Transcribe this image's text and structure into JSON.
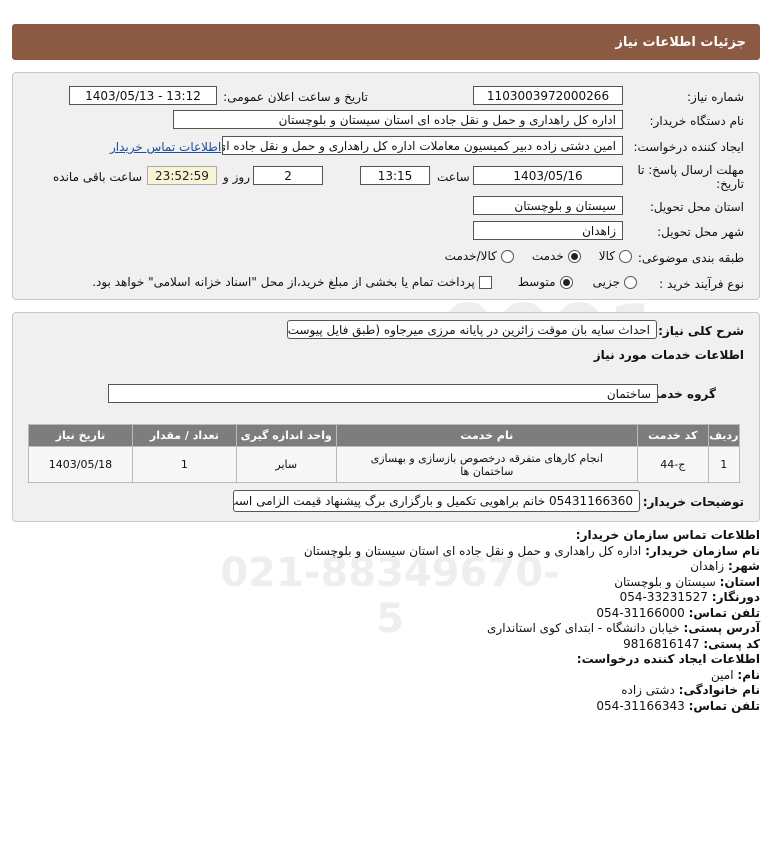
{
  "header": {
    "title": "جزئیات اطلاعات نیاز"
  },
  "need_number": {
    "label": "شماره نیاز:",
    "value": "1103003972000266"
  },
  "announce": {
    "label": "تاریخ و ساعت اعلان عمومی:",
    "value": "1403/05/13 - 13:12"
  },
  "buyer_org": {
    "label": "نام دستگاه خریدار:",
    "value": "اداره کل راهداری و حمل و نقل جاده ای استان سیستان و بلوچستان"
  },
  "requester": {
    "label": "ایجاد کننده درخواست:",
    "value": "امین دشتی زاده دبیر کمیسیون معاملات اداره کل راهداری و حمل و نقل جاده ای",
    "contact_link": "اطلاعات تماس خریدار"
  },
  "deadline": {
    "label_line1": "مهلت ارسال پاسخ: تا",
    "label_line2": "تاریخ:",
    "date": "1403/05/16",
    "time_label": "ساعت",
    "time": "13:15",
    "days": "2",
    "days_label": "روز و",
    "remaining": "23:52:59",
    "remaining_label": "ساعت باقی مانده"
  },
  "province": {
    "label": "استان محل تحویل:",
    "value": "سیستان و بلوچستان"
  },
  "city": {
    "label": "شهر محل تحویل:",
    "value": "زاهدان"
  },
  "category": {
    "label": "طبقه بندی موضوعی:",
    "options": [
      "کالا",
      "خدمت",
      "کالا/خدمت"
    ],
    "selected": "خدمت"
  },
  "process": {
    "label": "نوع فرآیند خرید :",
    "options": [
      "جزیی",
      "متوسط"
    ],
    "selected": "متوسط",
    "payment_note": "پرداخت تمام یا بخشی از مبلغ خرید،از محل \"اسناد خزانه اسلامی\" خواهد بود."
  },
  "description": {
    "label": "شرح کلی نیاز:",
    "value": "احداث سایه بان موقت زائرین در پایانه مرزی میرجاوه (طبق فایل پیوست)"
  },
  "services_info": {
    "title": "اطلاعات خدمات مورد نیاز"
  },
  "service_group": {
    "label": "گروه خدمت:",
    "value": "ساختمان"
  },
  "table": {
    "headers": [
      "ردیف",
      "کد خدمت",
      "نام خدمت",
      "واحد اندازه گیری",
      "تعداد / مقدار",
      "تاریخ نیاز"
    ],
    "rows": [
      [
        "1",
        "ج-44",
        "انجام کارهای متفرقه درخصوص بازسازی و بهسازی ساختمان ها",
        "سایر",
        "1",
        "1403/05/18"
      ]
    ]
  },
  "buyer_notes": {
    "label": "توضیحات خریدار:",
    "value": "05431166360 خانم براهویی تکمیل و بارگزاری برگ پیشنهاد قیمت الزامی است"
  },
  "contact": {
    "title": "اطلاعات تماس سازمان خریدار:",
    "org_label": "نام سازمان خریدار:",
    "org": "اداره کل راهداری و حمل و نقل جاده ای استان سیستان و بلوچستان",
    "city_label": "شهر:",
    "city": "زاهدان",
    "province_label": "استان:",
    "province": "سیستان و بلوچستان",
    "fax_label": "دورنگار:",
    "fax": "33231527-054",
    "phone_label": "تلفن تماس:",
    "phone": "31166000-054",
    "address_label": "آدرس پستی:",
    "address": "خیابان دانشگاه - ابتدای کوی استانداری",
    "postal_label": "کد پستی:",
    "postal": "9816816147",
    "creator_title": "اطلاعات ایجاد کننده درخواست:",
    "name_label": "نام:",
    "name": "امین",
    "family_label": "نام خانوادگی:",
    "family": "دشتی زاده",
    "creator_phone_label": "تلفن تماس:",
    "creator_phone": "31166343-054"
  }
}
